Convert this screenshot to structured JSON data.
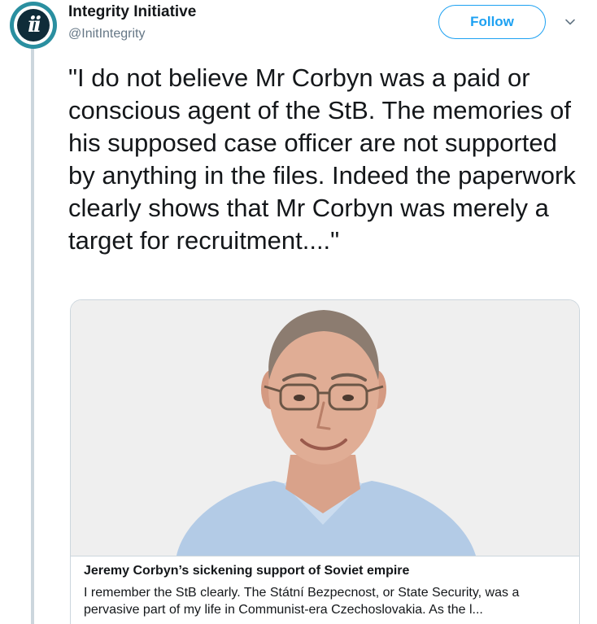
{
  "account": {
    "display_name": "Integrity Initiative",
    "handle": "@InitIntegrity",
    "avatar_label": "ii"
  },
  "follow_label": "Follow",
  "tweet": {
    "text": "\"I do not believe Mr Corbyn was a paid or conscious agent of the StB. The memories of his supposed case officer are not supported by anything in the files. Indeed the paperwork clearly shows that Mr Corbyn was merely a target for recruitment....\""
  },
  "card": {
    "title": "Jeremy Corbyn’s sickening support of Soviet empire",
    "description": "I remember the StB clearly. The Státní Bezpecnost, or State Security, was a pervasive part of my life in Communist-era Czechoslovakia. As the l..."
  },
  "colors": {
    "accent": "#1da1f2",
    "avatar_ring": "#2a8fa0",
    "thread_line": "#ccd6dd"
  },
  "icons": [
    "caret-down-icon"
  ]
}
